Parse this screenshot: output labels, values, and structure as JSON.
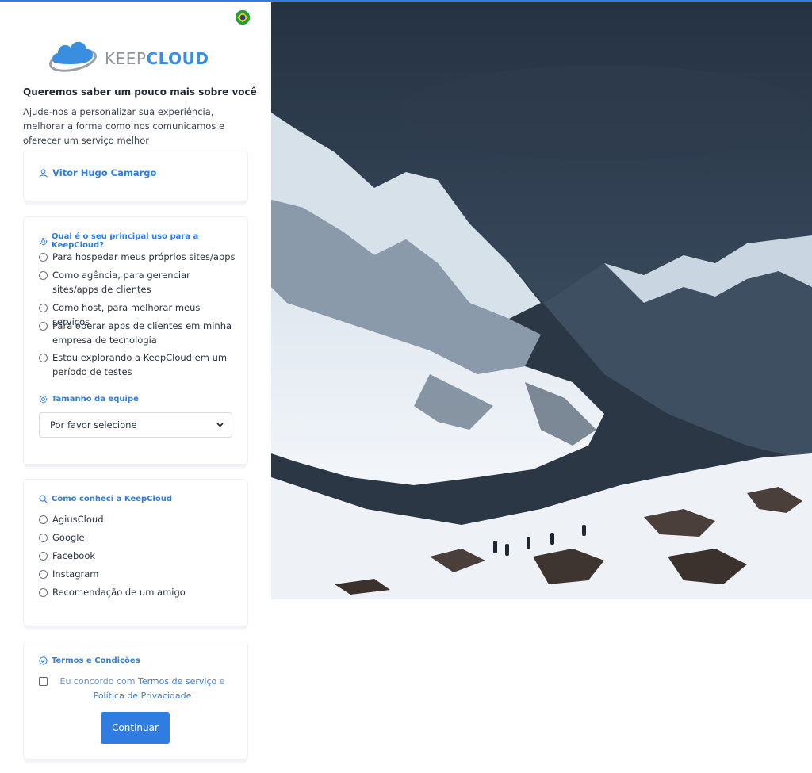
{
  "brand": {
    "keep": "KEEP",
    "cloud": "CLOUD"
  },
  "language_flag": "brazil-flag-icon",
  "intro": {
    "title": "Queremos saber um pouco mais sobre você",
    "description": "Ajude-nos a personalizar sua experiência, melhorar a forma como nos comunicamos e oferecer um serviço melhor"
  },
  "user": {
    "name": "Vitor Hugo Camargo"
  },
  "uso": {
    "question": "Qual é o seu principal uso para a KeepCloud?",
    "options": [
      "Para hospedar meus próprios sites/apps",
      "Como agência, para gerenciar sites/apps de clientes",
      "Como host, para melhorar meus serviços",
      "Para operar apps de clientes em minha empresa de tecnologia",
      "Estou explorando a KeepCloud em um período de testes"
    ],
    "team_label": "Tamanho da equipe",
    "team_select_value": "Por favor selecione"
  },
  "conheci": {
    "question": "Como conheci a KeepCloud",
    "options": [
      "AgiusCloud",
      "Google",
      "Facebook",
      "Instagram",
      "Recomendação de um amigo"
    ]
  },
  "termos": {
    "heading": "Termos e Condições",
    "prefix": "Eu concordo com ",
    "terms_link": "Termos de serviço",
    "conjunction": " e ",
    "privacy_link": "Política de Privacidade",
    "button": "Continuar"
  },
  "colors": {
    "accent": "#2f7de1",
    "sky": "#2f3d4e",
    "snow": "#e8eef4"
  }
}
